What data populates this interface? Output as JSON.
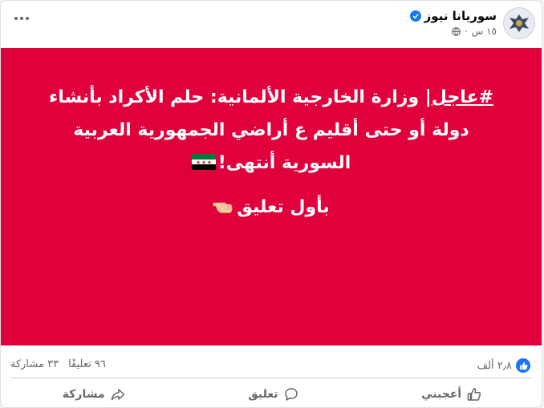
{
  "header": {
    "page_name": "سوريانا نيوز",
    "time": "١٥ س",
    "privacy_icon": "globe-icon",
    "more_icon": "more-dots-icon",
    "verified_icon": "verified-badge-icon"
  },
  "post": {
    "background_color": "#e0003b",
    "hashtag": "#عاجل",
    "line1_rest": "| وزارة الخارجية الألمانية: حلم الأكراد بأنشاء",
    "line2": "دولة أو حتى أقليم ع أراضي الجمهورية العربية",
    "line3": "السورية أنتهى!",
    "line3_emoji": "syrian-revolution-flag",
    "line4": "بأول تعليق",
    "line4_emoji": "pointing-hand"
  },
  "stats": {
    "reactions_count": "٢٫٨ ألف",
    "comments": "٩٦ تعليقًا",
    "shares": "٣٣ مشاركة"
  },
  "actions": {
    "like_label": "أعجبني",
    "comment_label": "تعليق",
    "share_label": "مشاركة"
  },
  "colors": {
    "accent": "#1877f2",
    "text_secondary": "#65676b"
  }
}
